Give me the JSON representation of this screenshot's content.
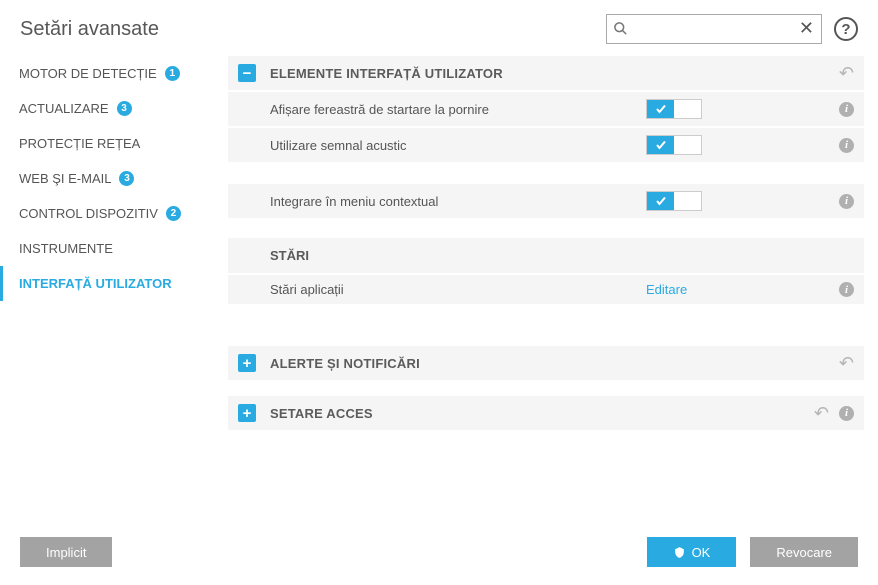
{
  "header": {
    "title": "Setări avansate",
    "search_placeholder": ""
  },
  "sidebar": {
    "items": [
      {
        "label": "MOTOR DE DETECȚIE",
        "badge": "1"
      },
      {
        "label": "ACTUALIZARE",
        "badge": "3"
      },
      {
        "label": "PROTECȚIE REȚEA",
        "badge": ""
      },
      {
        "label": "WEB ŞI E-MAIL",
        "badge": "3"
      },
      {
        "label": "CONTROL DISPOZITIV",
        "badge": "2"
      },
      {
        "label": "INSTRUMENTE",
        "badge": ""
      },
      {
        "label": "INTERFAȚĂ UTILIZATOR",
        "badge": ""
      }
    ]
  },
  "main": {
    "section_ui": {
      "title": "ELEMENTE INTERFAȚĂ UTILIZATOR",
      "row_splash": "Afișare fereastră de startare la pornire",
      "row_sound": "Utilizare semnal acustic",
      "row_context": "Integrare în meniu contextual",
      "sub_states": "STĂRI",
      "row_appstates_label": "Stări aplicații",
      "row_appstates_link": "Editare"
    },
    "section_alerts": {
      "title": "ALERTE ȘI NOTIFICĂRI"
    },
    "section_access": {
      "title": "SETARE ACCES"
    }
  },
  "footer": {
    "default_btn": "Implicit",
    "ok_btn": "OK",
    "cancel_btn": "Revocare"
  }
}
